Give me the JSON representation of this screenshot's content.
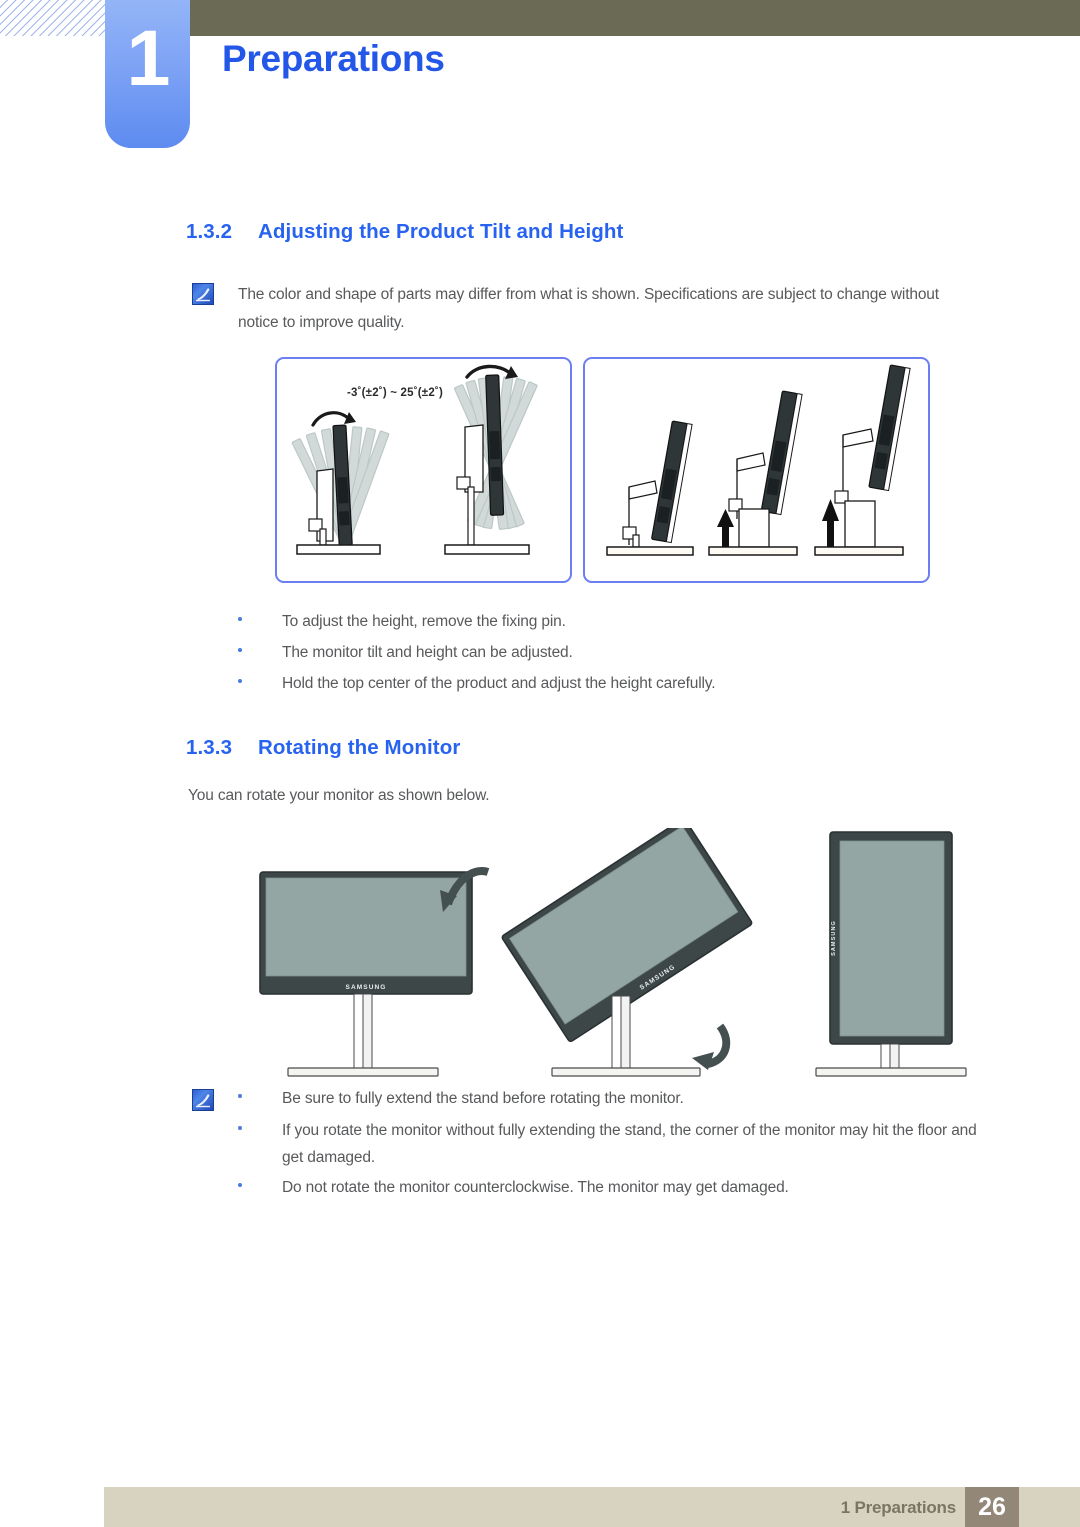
{
  "header": {
    "chapter_number": "1",
    "chapter_title": "Preparations"
  },
  "sections": [
    {
      "number": "1.3.2",
      "title": "Adjusting the Product Tilt and Height"
    },
    {
      "number": "1.3.3",
      "title": "Rotating the Monitor"
    }
  ],
  "note_1": {
    "icon": "note-pen-icon",
    "text": "The color and shape of parts may differ from what is shown. Specifications are subject to change without notice to improve quality."
  },
  "tilt_diagram": {
    "label": "-3˚(±2˚) ~ 25˚(±2˚)",
    "caption_left": "tilt-range-illustration",
    "caption_right": "height-adjustment-illustration"
  },
  "bullets_tilt": [
    "To adjust the height, remove the fixing pin.",
    "The monitor tilt and height can be adjusted.",
    "Hold the top center of the product and adjust the height carefully."
  ],
  "rotate_intro": "You can rotate your monitor as shown below.",
  "rotate_diagram": {
    "brand": "SAMSUNG",
    "states": [
      "landscape",
      "rotating",
      "portrait"
    ]
  },
  "note_2": {
    "icon": "note-pen-icon",
    "bullets": [
      "Be sure to fully extend the stand before rotating the monitor.",
      "If you rotate the monitor without fully extending the stand, the corner of the monitor may hit the floor and get damaged.",
      "Do not rotate the monitor counterclockwise. The monitor may get damaged."
    ]
  },
  "footer": {
    "label": "1 Preparations",
    "page": "26"
  },
  "colors": {
    "heading_blue": "#2763f0",
    "chapter_blue": "#2357e8",
    "tab_blue": "#7ea3f5",
    "olive": "#6b6a55",
    "body_gray": "#58595b",
    "bullet_blue": "#4a7ae0",
    "frame_blue": "#6b7ef2",
    "footer_band": "#d8d3c0",
    "footer_page_box": "#938878",
    "screen_gray": "#93a6a3",
    "bezel_dark": "#3d4748"
  }
}
